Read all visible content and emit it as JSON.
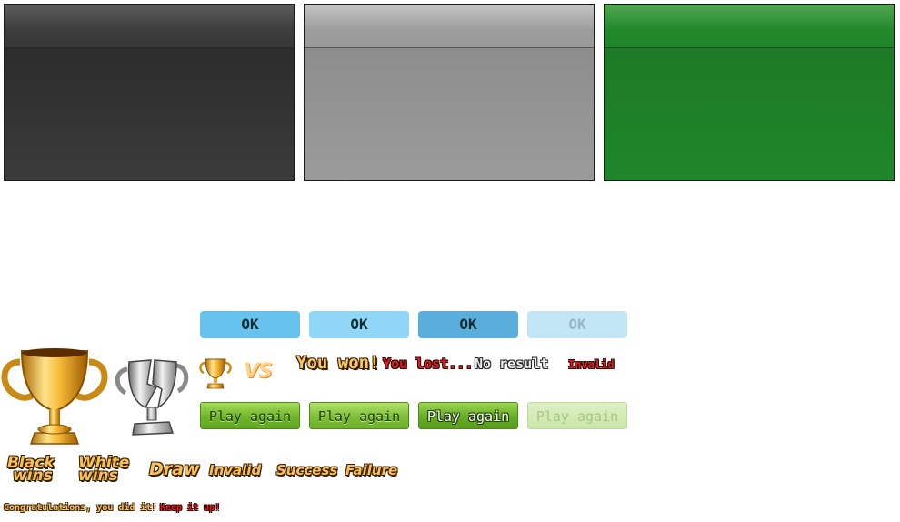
{
  "panels": {
    "dark_color": "#333333",
    "gray_color": "#999999",
    "green_color": "#1f862a"
  },
  "buttons": {
    "ok": [
      "OK",
      "OK",
      "OK",
      "OK"
    ],
    "play_again": [
      "Play again",
      "Play again",
      "Play again",
      "Play again"
    ]
  },
  "icons": {
    "gold_trophy": "gold-trophy-icon",
    "silver_broken_trophy": "broken-silver-trophy-icon",
    "small_trophy": "small-gold-trophy-icon"
  },
  "versus": "VS",
  "results": {
    "won": "You won!",
    "lost": "You lost...",
    "no_result": "No result",
    "invalid": "Invalid"
  },
  "labels": {
    "black_wins_line1": "Black",
    "black_wins_line2": "wins",
    "white_wins_line1": "White",
    "white_wins_line2": "wins",
    "draw": "Draw",
    "invalid": "Invalid",
    "success": "Success",
    "failure": "Failure"
  },
  "messages": {
    "congrats": "Congratulations, you did it!",
    "keep_up": "Keep it up!"
  },
  "colors": {
    "gold_text": "#f6c15c",
    "red_text": "#e01e1e",
    "ok_blue": "#68c2ee",
    "play_green": "#6fb52a"
  }
}
